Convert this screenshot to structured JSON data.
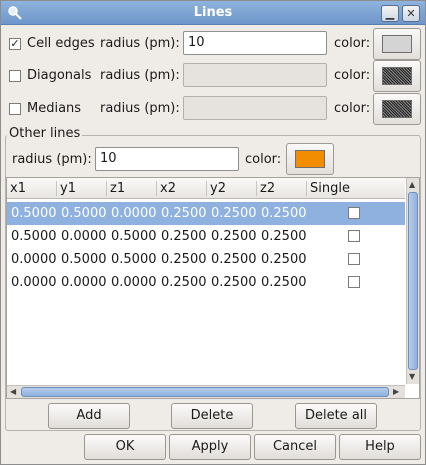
{
  "window": {
    "title": "Lines"
  },
  "options": [
    {
      "label": "Cell edges",
      "checked": true,
      "radius_label": "radius (pm):",
      "radius_value": "10",
      "color_label": "color:",
      "swatch": "#d4d4d4"
    },
    {
      "label": "Diagonals",
      "checked": false,
      "radius_label": "radius (pm):",
      "radius_value": "",
      "color_label": "color:",
      "swatch": "hatch"
    },
    {
      "label": "Medians",
      "checked": false,
      "radius_label": "radius (pm):",
      "radius_value": "",
      "color_label": "color:",
      "swatch": "hatch"
    }
  ],
  "other_lines": {
    "title": "Other lines",
    "radius_label": "radius (pm):",
    "radius_value": "10",
    "color_label": "color:",
    "swatch": "#f28c00"
  },
  "table": {
    "columns": [
      "x1",
      "y1",
      "z1",
      "x2",
      "y2",
      "z2",
      "Single"
    ],
    "rows": [
      [
        "0.5000",
        "0.5000",
        "0.0000",
        "0.2500",
        "0.2500",
        "0.2500"
      ],
      [
        "0.5000",
        "0.0000",
        "0.5000",
        "0.2500",
        "0.2500",
        "0.2500"
      ],
      [
        "0.0000",
        "0.5000",
        "0.5000",
        "0.2500",
        "0.2500",
        "0.2500"
      ],
      [
        "0.0000",
        "0.0000",
        "0.0000",
        "0.2500",
        "0.2500",
        "0.2500"
      ]
    ],
    "selected_row": 0
  },
  "table_buttons": {
    "add": "Add",
    "delete": "Delete",
    "delete_all": "Delete all"
  },
  "dialog_buttons": {
    "ok": "OK",
    "apply": "Apply",
    "cancel": "Cancel",
    "help": "Help"
  },
  "colors": {
    "selection": "#8fb1df",
    "titlebar": "#7fa5d4",
    "orange": "#f28c00"
  }
}
